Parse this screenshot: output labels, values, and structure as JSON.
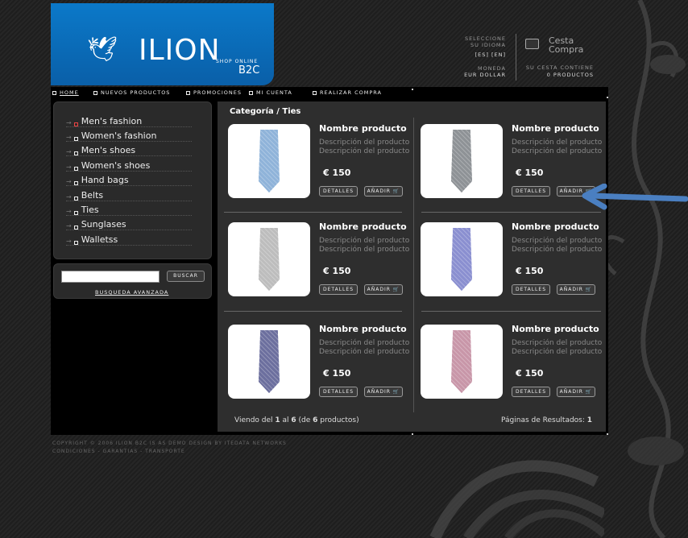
{
  "header": {
    "logo_text": "ILION",
    "logo_sub": "SHOP ONLINE",
    "logo_b2c": "B2C",
    "language_label_1": "SELECCIONE",
    "language_label_2": "SU IDIOMA",
    "languages": "[ES] [EN]",
    "currency_label": "MONEDA",
    "currency_value": "EUR DOLLAR",
    "cart_title_1": "Cesta",
    "cart_title_2": "Compra",
    "cart_status_1": "SU CESTA CONTIENE",
    "cart_status_2": "0 PRODUCTOS"
  },
  "nav": {
    "items": [
      "HOME",
      "NUEVOS PRODUCTOS",
      "PROMOCIONES",
      "MI CUENTA",
      "REALIZAR COMPRA"
    ]
  },
  "sidebar": {
    "categories": [
      "Men's fashion",
      "Women's fashion",
      "Men's shoes",
      "Women's shoes",
      "Hand bags",
      "Belts",
      "Ties",
      "Sunglases",
      "Walletss"
    ],
    "search_button": "BUSCAR",
    "advanced_search": "BUSQUEDA AVANZADA"
  },
  "content": {
    "breadcrumb": "Categoría / Ties",
    "products": [
      {
        "name": "Nombre producto",
        "desc1": "Descripción del producto",
        "desc2": "Descripción del producto",
        "price": "€ 150",
        "details": "DETALLES",
        "add": "AÑADIR",
        "tie_color": "#8fb3d9"
      },
      {
        "name": "Nombre producto",
        "desc1": "Descripción del producto",
        "desc2": "Descripción del producto",
        "price": "€ 150",
        "details": "DETALLES",
        "add": "AÑADIR",
        "tie_color": "#8e9296"
      },
      {
        "name": "Nombre producto",
        "desc1": "Descripción del producto",
        "desc2": "Descripción del producto",
        "price": "€ 150",
        "details": "DETALLES",
        "add": "AÑADIR",
        "tie_color": "#bdbdbd"
      },
      {
        "name": "Nombre producto",
        "desc1": "Descripción del producto",
        "desc2": "Descripción del producto",
        "price": "€ 150",
        "details": "DETALLES",
        "add": "AÑADIR",
        "tie_color": "#8a8fd0"
      },
      {
        "name": "Nombre producto",
        "desc1": "Descripción del producto",
        "desc2": "Descripción del producto",
        "price": "€ 150",
        "details": "DETALLES",
        "add": "AÑADIR",
        "tie_color": "#6c6f9e"
      },
      {
        "name": "Nombre producto",
        "desc1": "Descripción del producto",
        "desc2": "Descripción del producto",
        "price": "€ 150",
        "details": "DETALLES",
        "add": "AÑADIR",
        "tie_color": "#c896a8"
      }
    ],
    "results_prefix": "Viendo del ",
    "results_from": "1",
    "results_mid1": " al ",
    "results_to": "6",
    "results_mid2": " (de ",
    "results_total": "6",
    "results_suffix": " productos)",
    "pages_label": "Páginas de Resultados: ",
    "pages_value": "1"
  },
  "footer": {
    "line1": "COPYRIGHT © 2006 ILION B2C IS AS DEMO DESIGN BY ITEDATA NETWORKS",
    "line2": "CONDICIONES - GARANTIAS - TRANSPORTE"
  },
  "colors": {
    "brand_blue": "#0a6fbd",
    "annotation_arrow": "#4a7fc1"
  }
}
